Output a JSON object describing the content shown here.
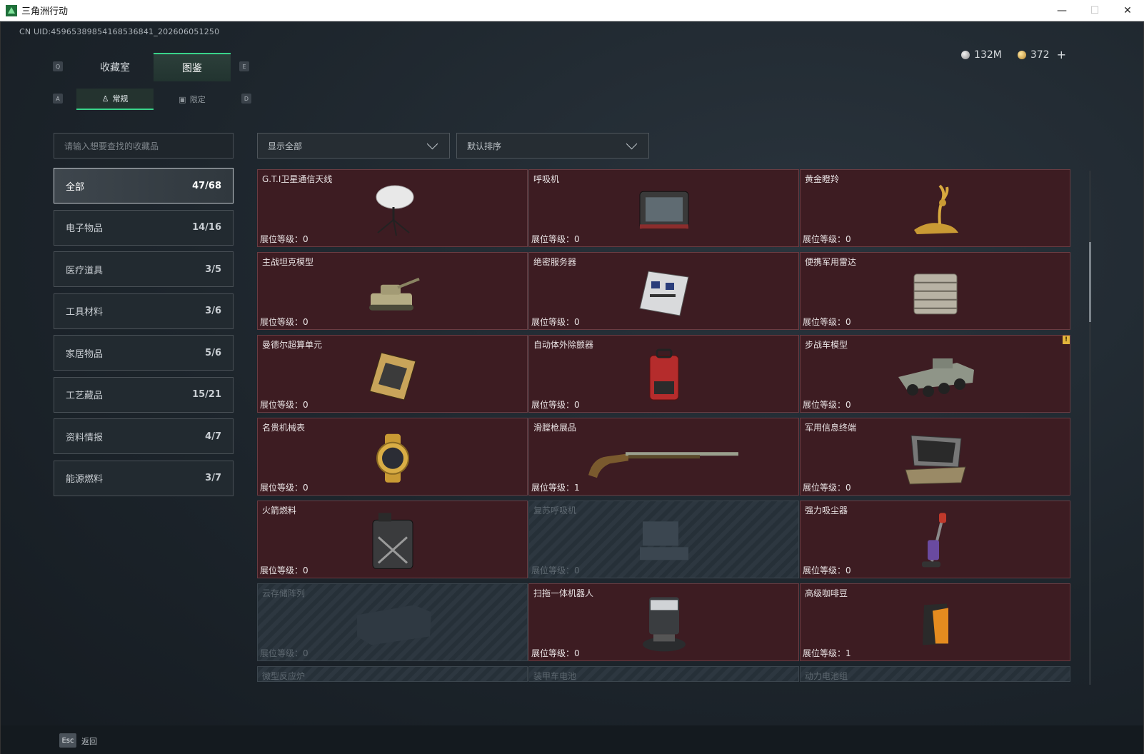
{
  "window": {
    "title": "三角洲行动",
    "minimize": "—",
    "maximize": "☐",
    "close": "✕"
  },
  "header": {
    "uid": "CN UID:4596538985416853684​1_202606051250"
  },
  "currency": {
    "silver": "132M",
    "gold": "372",
    "add": "+"
  },
  "keys": {
    "prev_tab": "Q",
    "next_tab": "E",
    "prev_sub": "A",
    "next_sub": "D"
  },
  "tabs": [
    {
      "label": "收藏室"
    },
    {
      "label": "图鉴",
      "active": true
    }
  ],
  "subtabs": [
    {
      "label": "常规",
      "active": true
    },
    {
      "label": "限定"
    }
  ],
  "search": {
    "placeholder": "请输入想要查找的收藏品"
  },
  "filters": {
    "show": "显示全部",
    "sort": "默认排序"
  },
  "categories": [
    {
      "label": "全部",
      "count": "47/68",
      "active": true
    },
    {
      "label": "电子物品",
      "count": "14/16"
    },
    {
      "label": "医疗道具",
      "count": "3/5"
    },
    {
      "label": "工具材料",
      "count": "3/6"
    },
    {
      "label": "家居物品",
      "count": "5/6"
    },
    {
      "label": "工艺藏品",
      "count": "15/21"
    },
    {
      "label": "资料情报",
      "count": "4/7"
    },
    {
      "label": "能源燃料",
      "count": "3/7"
    }
  ],
  "level_label": "展位等级：",
  "items": [
    {
      "name": "G.T.I卫星通信天线",
      "level": "0",
      "icon": "satellite-dish-icon"
    },
    {
      "name": "呼吸机",
      "level": "0",
      "icon": "ventilator-icon"
    },
    {
      "name": "黄金瞪羚",
      "level": "0",
      "icon": "golden-gazelle-icon"
    },
    {
      "name": "主战坦克模型",
      "level": "0",
      "icon": "tank-model-icon"
    },
    {
      "name": "绝密服务器",
      "level": "0",
      "icon": "server-icon"
    },
    {
      "name": "便携军用雷达",
      "level": "0",
      "icon": "radar-icon"
    },
    {
      "name": "曼德尔超算单元",
      "level": "0",
      "icon": "compute-unit-icon"
    },
    {
      "name": "自动体外除颤器",
      "level": "0",
      "icon": "defibrillator-icon"
    },
    {
      "name": "步战车模型",
      "level": "0",
      "icon": "ifv-model-icon",
      "warn": "!"
    },
    {
      "name": "名贵机械表",
      "level": "0",
      "icon": "watch-icon"
    },
    {
      "name": "滑膛枪展品",
      "level": "1",
      "icon": "musket-icon"
    },
    {
      "name": "军用信息终端",
      "level": "0",
      "icon": "terminal-icon"
    },
    {
      "name": "火箭燃料",
      "level": "0",
      "icon": "fuel-can-icon"
    },
    {
      "name": "复苏呼吸机",
      "level": "0",
      "icon": "resuscitator-icon",
      "locked": true
    },
    {
      "name": "强力吸尘器",
      "level": "0",
      "icon": "vacuum-icon"
    },
    {
      "name": "云存储阵列",
      "level": "0",
      "icon": "storage-array-icon",
      "locked": true
    },
    {
      "name": "扫拖一体机器人",
      "level": "0",
      "icon": "robot-mop-icon"
    },
    {
      "name": "高级咖啡豆",
      "level": "1",
      "icon": "coffee-bag-icon"
    },
    {
      "name": "微型反应炉",
      "locked": true
    },
    {
      "name": "装甲车电池",
      "locked": true
    },
    {
      "name": "动力电池组",
      "locked": true
    }
  ],
  "footer": {
    "esc": "Esc",
    "back": "返回"
  },
  "colors": {
    "accent": "#39d38a",
    "card_bg": "#3d1c22",
    "warn": "#e3b53b"
  }
}
